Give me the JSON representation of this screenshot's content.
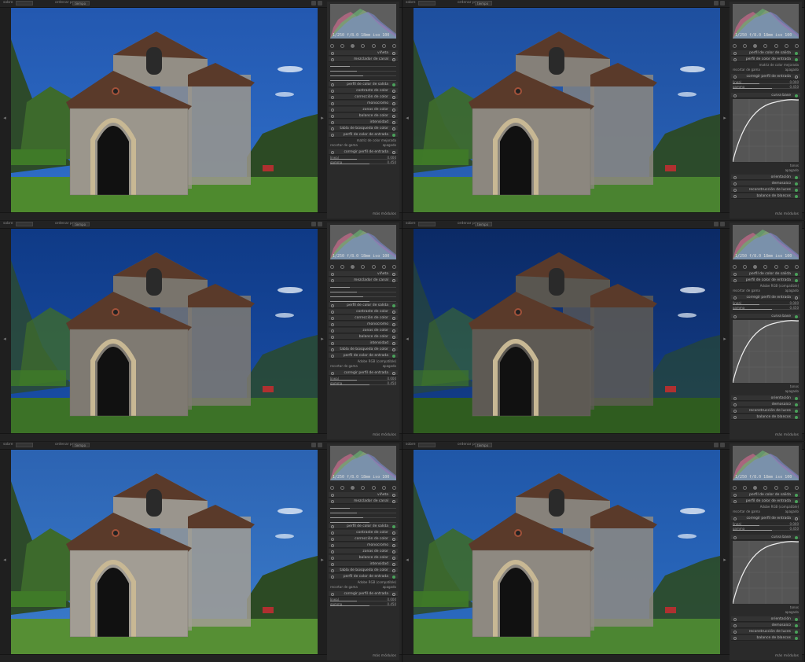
{
  "topbar": {
    "filter_label": "sobre",
    "sort_label": "ordenar por",
    "sort_value": "tiempo"
  },
  "bottombar": {
    "more_label": "más módulos"
  },
  "histogram": {
    "exif": "1/250 f/8.0 18mm iso 100"
  },
  "colors": {
    "panel_bg": "#2a2a2a",
    "module_bg": "#333333",
    "active_green": "#4aa05a",
    "histogram_bg": "#5e5e5e"
  },
  "panels": [
    {
      "id": "top-left",
      "modules": [
        {
          "name": "viñeta",
          "dot": "plain"
        },
        {
          "name": "mezclador de canal",
          "dot": "plain",
          "expanded": true
        },
        {
          "name": "perfil de color de salida",
          "dot": "green"
        },
        {
          "name": "contraste de color",
          "dot": "plain"
        },
        {
          "name": "corrección de color",
          "dot": "plain"
        },
        {
          "name": "monocromo",
          "dot": "plain"
        },
        {
          "name": "zonas de color",
          "dot": "plain"
        },
        {
          "name": "balance de color",
          "dot": "plain"
        },
        {
          "name": "intensidad",
          "dot": "plain"
        },
        {
          "name": "tabla de búsqueda de color",
          "dot": "plain"
        },
        {
          "name": "perfil de color de entrada",
          "dot": "green",
          "expanded": true
        },
        {
          "name": "corregir perfil de entrada",
          "dot": "plain",
          "expanded": true
        }
      ],
      "input_profile_value": "matriz de color mejorada",
      "gamma_label": "recortar de gama",
      "gamma_value": "apagado",
      "sliders": [
        {
          "label": "lineal",
          "value": "0.000"
        },
        {
          "label": "gamma",
          "value": "0.450"
        }
      ]
    },
    {
      "id": "top-right",
      "modules": [
        {
          "name": "perfil de color de salida",
          "dot": "green"
        },
        {
          "name": "perfil de color de entrada",
          "dot": "green",
          "expanded": true
        },
        {
          "name": "corregir perfil de entrada",
          "dot": "plain",
          "expanded": true
        },
        {
          "name": "curva base",
          "dot": "green",
          "expanded": true
        },
        {
          "name": "orientación",
          "dot": "green"
        },
        {
          "name": "demosaico",
          "dot": "green"
        },
        {
          "name": "reconstrucción de luces",
          "dot": "green"
        },
        {
          "name": "balance de blancos",
          "dot": "green"
        }
      ],
      "input_profile_value": "matriz de color mejorada",
      "gamma_label": "recortar de gama",
      "gamma_value": "apagado",
      "sliders": [
        {
          "label": "lineal",
          "value": "0.000"
        },
        {
          "label": "gamma",
          "value": "0.450"
        }
      ],
      "curve_preset": "tonos",
      "curve_mode": "apagado"
    },
    {
      "id": "middle-left",
      "modules": [
        {
          "name": "viñeta",
          "dot": "plain"
        },
        {
          "name": "mezclador de canal",
          "dot": "plain",
          "expanded": true
        },
        {
          "name": "perfil de color de salida",
          "dot": "green"
        },
        {
          "name": "contraste de color",
          "dot": "plain"
        },
        {
          "name": "corrección de color",
          "dot": "plain"
        },
        {
          "name": "monocromo",
          "dot": "plain"
        },
        {
          "name": "zonas de color",
          "dot": "plain"
        },
        {
          "name": "balance de color",
          "dot": "plain"
        },
        {
          "name": "intensidad",
          "dot": "plain"
        },
        {
          "name": "tabla de búsqueda de color",
          "dot": "plain"
        },
        {
          "name": "perfil de color de entrada",
          "dot": "green",
          "expanded": true
        },
        {
          "name": "corregir perfil de entrada",
          "dot": "plain",
          "expanded": true
        }
      ],
      "input_profile_value": "Adobe RGB (compatible)",
      "gamma_label": "recortar de gama",
      "gamma_value": "apagado",
      "sliders": [
        {
          "label": "lineal",
          "value": "0.000"
        },
        {
          "label": "gamma",
          "value": "0.450"
        }
      ]
    },
    {
      "id": "middle-right",
      "modules": [
        {
          "name": "perfil de color de salida",
          "dot": "green"
        },
        {
          "name": "perfil de color de entrada",
          "dot": "green",
          "expanded": true
        },
        {
          "name": "corregir perfil de entrada",
          "dot": "plain",
          "expanded": true
        },
        {
          "name": "curva base",
          "dot": "green",
          "expanded": true
        },
        {
          "name": "orientación",
          "dot": "green"
        },
        {
          "name": "demosaico",
          "dot": "green"
        },
        {
          "name": "reconstrucción de luces",
          "dot": "green"
        },
        {
          "name": "balance de blancos",
          "dot": "green"
        }
      ],
      "input_profile_value": "Adobe RGB (compatible)",
      "gamma_label": "recortar de gama",
      "gamma_value": "apagado",
      "sliders": [
        {
          "label": "lineal",
          "value": "0.000"
        },
        {
          "label": "gamma",
          "value": "0.450"
        }
      ],
      "curve_preset": "tonos",
      "curve_mode": "apagado"
    },
    {
      "id": "bottom-left",
      "modules": [
        {
          "name": "viñeta",
          "dot": "plain"
        },
        {
          "name": "mezclador de canal",
          "dot": "plain",
          "expanded": true
        },
        {
          "name": "perfil de color de salida",
          "dot": "green"
        },
        {
          "name": "contraste de color",
          "dot": "plain"
        },
        {
          "name": "corrección de color",
          "dot": "plain"
        },
        {
          "name": "monocromo",
          "dot": "plain"
        },
        {
          "name": "zonas de color",
          "dot": "plain"
        },
        {
          "name": "balance de color",
          "dot": "plain"
        },
        {
          "name": "intensidad",
          "dot": "plain"
        },
        {
          "name": "tabla de búsqueda de color",
          "dot": "plain"
        },
        {
          "name": "perfil de color de entrada",
          "dot": "green",
          "expanded": true
        },
        {
          "name": "corregir perfil de entrada",
          "dot": "plain",
          "expanded": true
        }
      ],
      "input_profile_value": "Adobe RGB (compatible)",
      "gamma_label": "recortar de gama",
      "gamma_value": "apagado",
      "sliders": [
        {
          "label": "lineal",
          "value": "0.000"
        },
        {
          "label": "gamma",
          "value": "0.450"
        }
      ]
    },
    {
      "id": "bottom-right",
      "modules": [
        {
          "name": "perfil de color de salida",
          "dot": "green"
        },
        {
          "name": "perfil de color de entrada",
          "dot": "green",
          "expanded": true
        },
        {
          "name": "corregir perfil de entrada",
          "dot": "plain",
          "expanded": true
        },
        {
          "name": "curva base",
          "dot": "green",
          "expanded": true
        },
        {
          "name": "orientación",
          "dot": "green"
        },
        {
          "name": "demosaico",
          "dot": "green"
        },
        {
          "name": "reconstrucción de luces",
          "dot": "green"
        },
        {
          "name": "balance de blancos",
          "dot": "green"
        }
      ],
      "input_profile_value": "Adobe RGB (compatible)",
      "gamma_label": "recortar de gama",
      "gamma_value": "apagado",
      "sliders": [
        {
          "label": "lineal",
          "value": "0.000"
        },
        {
          "label": "gamma",
          "value": "0.450"
        }
      ],
      "curve_preset": "tonos",
      "curve_mode": "apagado"
    }
  ],
  "photo_variants": [
    {
      "sky": "#2f6fc9",
      "sky_top": "#2358b0",
      "grass": "#4e8a2e",
      "stone": "#9b968c",
      "dark": 1.0
    },
    {
      "sky": "#2a63b8",
      "sky_top": "#1e4f9f",
      "grass": "#4a8330",
      "stone": "#8c877f",
      "dark": 0.95
    },
    {
      "sky": "#1a4fa8",
      "sky_top": "#0f3a86",
      "grass": "#3c7227",
      "stone": "#7f7a72",
      "dark": 0.8
    },
    {
      "sky": "#143f8c",
      "sky_top": "#0b2a66",
      "grass": "#2f5c1f",
      "stone": "#5e5a54",
      "dark": 0.6
    },
    {
      "sky": "#3a7ccc",
      "sky_top": "#2c63b2",
      "grass": "#568f34",
      "stone": "#a29d94",
      "dark": 1.0
    },
    {
      "sky": "#2c6cc2",
      "sky_top": "#2057a8",
      "grass": "#4c8632",
      "stone": "#8e8981",
      "dark": 0.9
    }
  ]
}
